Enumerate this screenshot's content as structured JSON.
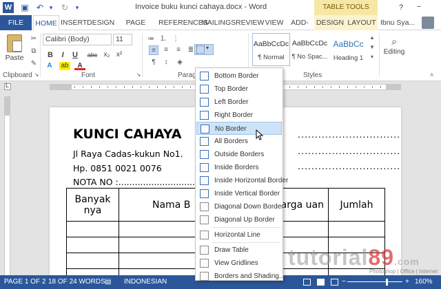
{
  "window": {
    "title": "Invoice buku kunci cahaya.docx - Word",
    "contextual_label": "TABLE TOOLS",
    "help_icon_glyph": "?",
    "minimize_glyph": "−"
  },
  "quick_access": {
    "save_icon": "floppy-icon",
    "undo_glyph": "↶",
    "redo_glyph": "↻",
    "save_glyph": "▣"
  },
  "tabs": [
    {
      "label": "FILE"
    },
    {
      "label": "HOME"
    },
    {
      "label": "INSERT"
    },
    {
      "label": "DESIGN"
    },
    {
      "label": "PAGE LAYOUT"
    },
    {
      "label": "REFERENCES"
    },
    {
      "label": "MAILINGS"
    },
    {
      "label": "REVIEW"
    },
    {
      "label": "VIEW"
    },
    {
      "label": "ADD-INS"
    },
    {
      "label": "DESIGN"
    },
    {
      "label": "LAYOUT"
    }
  ],
  "user": {
    "name": "Ibnu Sya..."
  },
  "ribbon": {
    "clipboard": {
      "paste_label": "Paste",
      "group_label": "Clipboard"
    },
    "font": {
      "font_name": "Calibri (Body)",
      "font_size": "11",
      "group_label": "Font",
      "bold": "B",
      "italic": "I",
      "underline": "U",
      "strike": "abc",
      "subscript": "x₂",
      "superscript": "x²",
      "text_effects": "A",
      "highlight": "ab",
      "font_color": "A"
    },
    "paragraph": {
      "group_label": "Parag"
    },
    "styles": {
      "group_label": "Styles",
      "items": [
        {
          "sample": "AaBbCcDc",
          "name": "¶ Normal"
        },
        {
          "sample": "AaBbCcDc",
          "name": "¶ No Spac..."
        },
        {
          "sample": "AaBbCc",
          "name": "Heading 1"
        }
      ]
    },
    "editing": {
      "label": "Editing",
      "icon_glyph": "⌕"
    },
    "collapse_glyph": "˄"
  },
  "ruler": {
    "tab_selector": "L"
  },
  "document": {
    "title": "KUNCI CAHAYA",
    "address": "Jl Raya Cadas-kukun No1.",
    "phone": "Hp. 0851 0021 0076",
    "nota": "NOTA NO :.......................................",
    "right_dots": "..............................",
    "table_headers": [
      "Banyak nya",
      "Nama B",
      "arga uan",
      "Jumlah"
    ],
    "table_rows": 4
  },
  "borders_menu": {
    "items": [
      {
        "label": "Bottom Border",
        "icon": "bottom-border-icon"
      },
      {
        "label": "Top Border",
        "icon": "top-border-icon"
      },
      {
        "label": "Left Border",
        "icon": "left-border-icon"
      },
      {
        "label": "Right Border",
        "icon": "right-border-icon"
      },
      {
        "label": "No Border",
        "icon": "no-border-icon"
      },
      {
        "label": "All Borders",
        "icon": "all-borders-icon"
      },
      {
        "label": "Outside Borders",
        "icon": "outside-borders-icon"
      },
      {
        "label": "Inside Borders",
        "icon": "inside-borders-icon"
      },
      {
        "label": "Inside Horizontal Border",
        "icon": "inside-horizontal-border-icon"
      },
      {
        "label": "Inside Vertical Border",
        "icon": "inside-vertical-border-icon"
      },
      {
        "label": "Diagonal Down Border",
        "icon": "diagonal-down-border-icon"
      },
      {
        "label": "Diagonal Up Border",
        "icon": "diagonal-up-border-icon"
      },
      {
        "label": "Horizontal Line",
        "icon": "horizontal-line-icon"
      },
      {
        "label": "Draw Table",
        "icon": "draw-table-icon"
      },
      {
        "label": "View Gridlines",
        "icon": "view-gridlines-icon"
      },
      {
        "label": "Borders and Shading...",
        "icon": "borders-shading-icon"
      }
    ],
    "hovered": "No Border"
  },
  "status": {
    "page": "PAGE 1 OF 2",
    "words": "18 OF 24 WORDS",
    "language": "INDONESIAN",
    "zoom": "160%"
  },
  "watermark": {
    "prefix": "tut",
    "middle": "orial",
    "suffix": "89",
    "dotcom": ".com",
    "tagline": "Photoshop | Office | Internet"
  },
  "colors": {
    "word_blue": "#2b579a",
    "table_tools_bg": "#f6e7a5",
    "menu_hover": "#cde3f7"
  }
}
